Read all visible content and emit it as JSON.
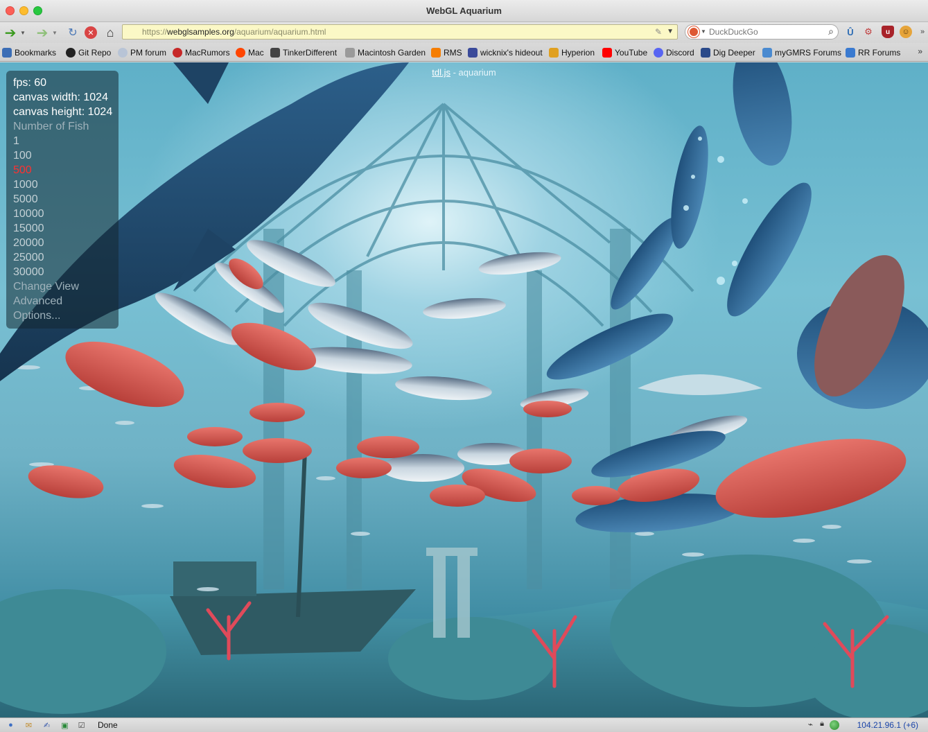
{
  "window": {
    "title": "WebGL Aquarium"
  },
  "toolbar": {
    "url_prefix": "https://",
    "url_domain": "webglsamples.org",
    "url_path": "/aquarium/aquarium.html",
    "search_placeholder": "DuckDuckGo"
  },
  "bookmarks": [
    {
      "label": "Bookmarks",
      "icon": "folder-icon",
      "color": "#3b6db5"
    },
    {
      "label": "Git Repo",
      "icon": "github-icon",
      "color": "#222222"
    },
    {
      "label": "PM forum",
      "icon": "sphere-icon",
      "color": "#b8c4d6"
    },
    {
      "label": "MacRumors",
      "icon": "apple-icon",
      "color": "#c62828"
    },
    {
      "label": "Mac",
      "icon": "reddit-icon",
      "color": "#ff4500"
    },
    {
      "label": "TinkerDifferent",
      "icon": "tinker-icon",
      "color": "#444444"
    },
    {
      "label": "Macintosh Garden",
      "icon": "mac-icon",
      "color": "#9a9a9a"
    },
    {
      "label": "RMS",
      "icon": "blogger-icon",
      "color": "#f57d00"
    },
    {
      "label": "wicknix's hideout",
      "icon": "wicknix-icon",
      "color": "#3a4a9a"
    },
    {
      "label": "Hyperion",
      "icon": "hyperion-icon",
      "color": "#e0a020"
    },
    {
      "label": "YouTube",
      "icon": "youtube-icon",
      "color": "#ff0000"
    },
    {
      "label": "Discord",
      "icon": "discord-icon",
      "color": "#5865f2"
    },
    {
      "label": "Dig Deeper",
      "icon": "digdeeper-icon",
      "color": "#2a4a8a"
    },
    {
      "label": "myGMRS Forums",
      "icon": "gmrs-icon",
      "color": "#4a8ad0"
    },
    {
      "label": "RR Forums",
      "icon": "rr-icon",
      "color": "#3a7ad0"
    }
  ],
  "page": {
    "title_link": "tdl.js",
    "title_rest": " - aquarium",
    "fps": "fps: 60",
    "canvas_width": "canvas width: 1024",
    "canvas_height": "canvas height: 1024",
    "fish_heading": "Number of Fish",
    "fish_options": [
      "1",
      "100",
      "500",
      "1000",
      "5000",
      "10000",
      "15000",
      "20000",
      "25000",
      "30000"
    ],
    "selected_option": "500",
    "menu": [
      "Change View",
      "Advanced",
      "Options..."
    ]
  },
  "statusbar": {
    "status": "Done",
    "ip": "104.21.96.1 (+6)"
  },
  "colors": {
    "active_option": "#ff3030",
    "water": "#6fb2c6",
    "red_fish": "#d9534f",
    "tuna": "#9fb8c8"
  }
}
